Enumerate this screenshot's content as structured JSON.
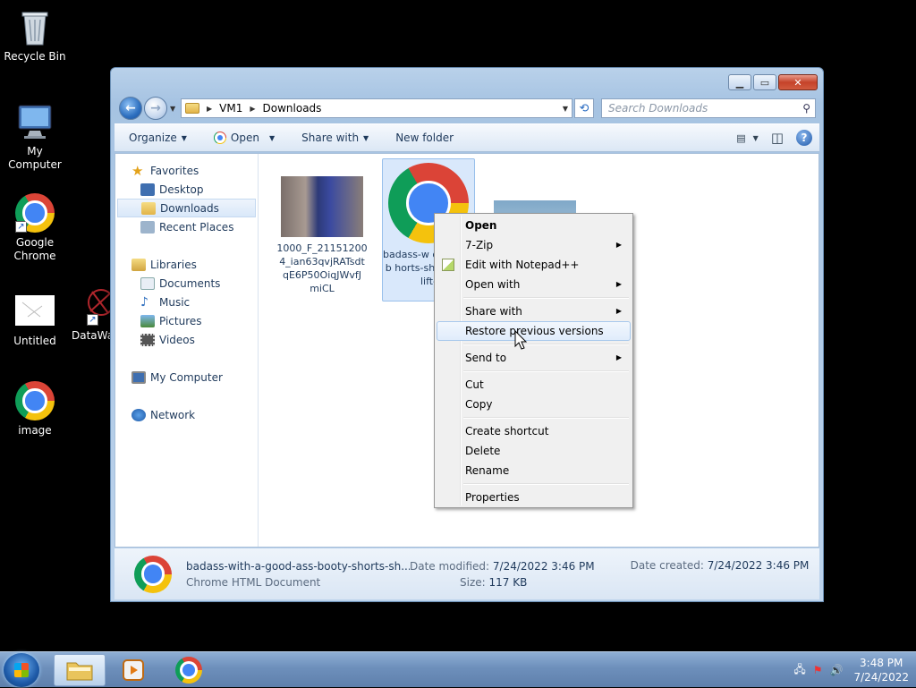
{
  "desktop": {
    "icons": [
      {
        "label": "Recycle Bin",
        "icon": "recycle-bin-icon"
      },
      {
        "label": "My Computer",
        "icon": "computer-icon"
      },
      {
        "label": "Google Chrome",
        "icon": "chrome-icon"
      },
      {
        "label": "Untitled",
        "icon": "image-file-icon"
      },
      {
        "label": "DataWa",
        "icon": "datawa-icon"
      },
      {
        "label": "image",
        "icon": "chrome-icon"
      }
    ]
  },
  "window": {
    "breadcrumb": [
      "VM1",
      "Downloads"
    ],
    "search_placeholder": "Search Downloads",
    "toolbar": {
      "organize": "Organize",
      "open": "Open",
      "share_with": "Share with",
      "new_folder": "New folder"
    },
    "nav": {
      "favorites": "Favorites",
      "desktop": "Desktop",
      "downloads": "Downloads",
      "recent_places": "Recent Places",
      "libraries": "Libraries",
      "documents": "Documents",
      "music": "Music",
      "pictures": "Pictures",
      "videos": "Videos",
      "my_computer": "My Computer",
      "network": "Network"
    },
    "files": [
      {
        "name": "1000_F_21151200 4_ian63qvjRATsdt qE6P50OiqJWvfJ miCL",
        "type": "image"
      },
      {
        "name": "badass-w ood-ass-b horts-sho -who-lift-",
        "type": "chrome-html",
        "selected": true
      },
      {
        "name": "",
        "type": "image"
      }
    ],
    "details": {
      "name": "badass-with-a-good-ass-booty-shorts-sh...",
      "type": "Chrome HTML Document",
      "modified_label": "Date modified:",
      "modified_value": "7/24/2022 3:46 PM",
      "size_label": "Size:",
      "size_value": "117 KB",
      "created_label": "Date created:",
      "created_value": "7/24/2022 3:46 PM"
    }
  },
  "context_menu": {
    "items": [
      {
        "label": "Open",
        "bold": true
      },
      {
        "label": "7-Zip",
        "submenu": true
      },
      {
        "label": "Edit with Notepad++",
        "icon": "notepad-icon"
      },
      {
        "label": "Open with",
        "submenu": true
      },
      {
        "label": "Share with",
        "submenu": true
      },
      {
        "label": "Restore previous versions",
        "hover": true
      },
      {
        "label": "Send to",
        "submenu": true
      },
      {
        "label": "Cut"
      },
      {
        "label": "Copy"
      },
      {
        "label": "Create shortcut"
      },
      {
        "label": "Delete"
      },
      {
        "label": "Rename"
      },
      {
        "label": "Properties"
      }
    ]
  },
  "taskbar": {
    "time": "3:48 PM",
    "date": "7/24/2022"
  }
}
